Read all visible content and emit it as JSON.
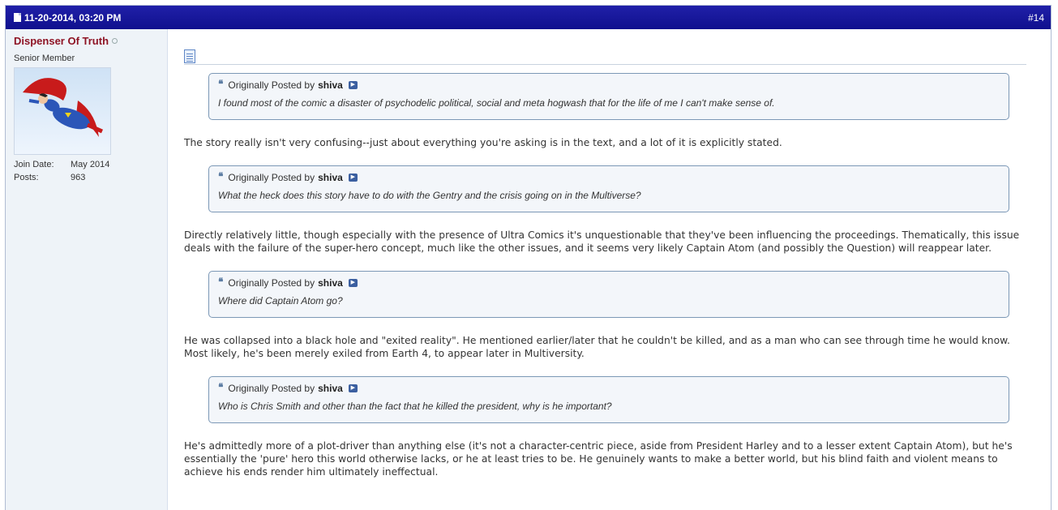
{
  "post": {
    "date": "11-20-2014, 03:20 PM",
    "number": "#14"
  },
  "user": {
    "name": "Dispenser Of Truth",
    "title": "Senior Member",
    "join_label": "Join Date:",
    "join_value": "May 2014",
    "posts_label": "Posts:",
    "posts_value": "963"
  },
  "content": {
    "quotes": [
      {
        "prefix": "Originally Posted by",
        "author": "shiva",
        "text": "I found most of the comic a disaster of psychodelic political, social and meta hogwash that for the life of me I can't make sense of."
      },
      {
        "prefix": "Originally Posted by",
        "author": "shiva",
        "text": "What the heck does this story have to do with the Gentry and the crisis going on in the Multiverse?"
      },
      {
        "prefix": "Originally Posted by",
        "author": "shiva",
        "text": "Where did Captain Atom go?"
      },
      {
        "prefix": "Originally Posted by",
        "author": "shiva",
        "text": "Who is Chris Smith and other than the fact that he killed the president, why is he important?"
      }
    ],
    "paragraphs": [
      "The story really isn't very confusing--just about everything you're asking is in the text, and a lot of it is explicitly stated.",
      "Directly relatively little, though especially with the presence of Ultra Comics it's unquestionable that they've been influencing the proceedings. Thematically, this issue deals with the failure of the super-hero concept, much like the other issues, and it seems very likely Captain Atom (and possibly the Question) will reappear later.",
      "He was collapsed into a black hole and \"exited reality\". He mentioned earlier/later that he couldn't be killed, and as a man who can see through time he would know. Most likely, he's been merely exiled from Earth 4, to appear later in Multiversity.",
      "He's admittedly more of a plot-driver than anything else (it's not a character-centric piece, aside from President Harley and to a lesser extent Captain Atom), but he's essentially the 'pure' hero this world otherwise lacks, or he at least tries to be. He genuinely wants to make a better world, but his blind faith and violent means to achieve his ends render him ultimately ineffectual."
    ]
  },
  "icons": {
    "post": "post-icon",
    "status": "offline-status-icon",
    "message": "post-message-icon",
    "quote": "quote-icon",
    "view": "view-post-icon"
  },
  "colors": {
    "header": "#1a1a9e",
    "username": "#8e1324",
    "sidebar": "#eef3f8",
    "quote_border": "#7c98b6"
  }
}
